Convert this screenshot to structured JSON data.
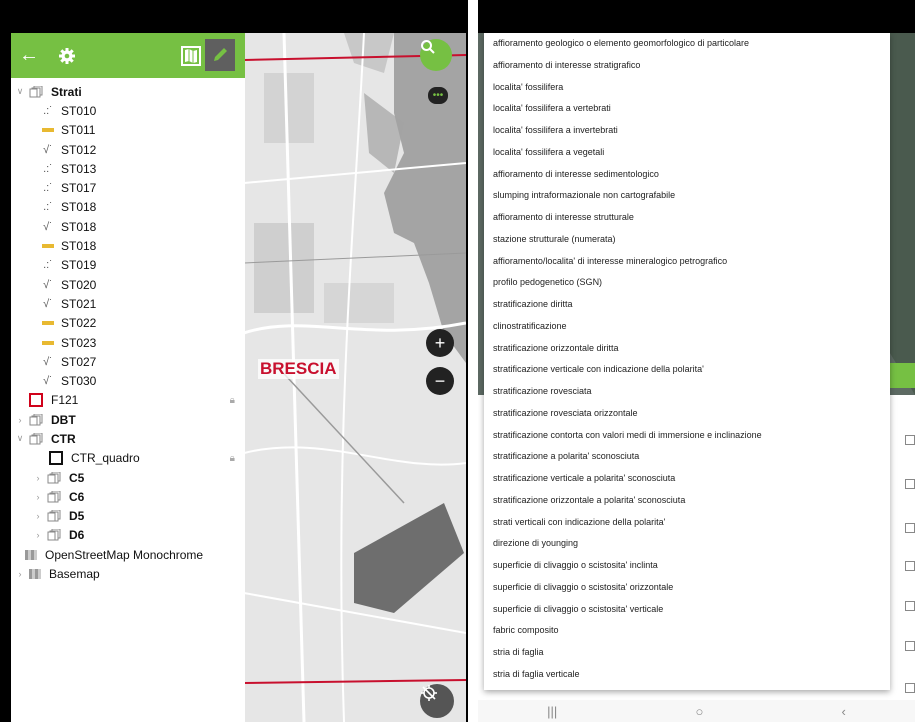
{
  "toolbar": {
    "back_icon": "arrow-left-icon",
    "settings_icon": "gear-icon",
    "map_icon": "map-icon",
    "edit_icon": "pencil-icon"
  },
  "tree": {
    "strati": {
      "label": "Strati"
    },
    "strati_items": [
      {
        "label": "ST010",
        "symbol": "dots"
      },
      {
        "label": "ST011",
        "symbol": "bar"
      },
      {
        "label": "ST012",
        "symbol": "check"
      },
      {
        "label": "ST013",
        "symbol": "dots"
      },
      {
        "label": "ST017",
        "symbol": "dots"
      },
      {
        "label": "ST018",
        "symbol": "dots"
      },
      {
        "label": "ST018",
        "symbol": "check"
      },
      {
        "label": "ST018",
        "symbol": "bar"
      },
      {
        "label": "ST019",
        "symbol": "dots"
      },
      {
        "label": "ST020",
        "symbol": "check"
      },
      {
        "label": "ST021",
        "symbol": "check"
      },
      {
        "label": "ST022",
        "symbol": "bar"
      },
      {
        "label": "ST023",
        "symbol": "bar"
      },
      {
        "label": "ST027",
        "symbol": "check"
      },
      {
        "label": "ST030",
        "symbol": "check"
      }
    ],
    "f121": {
      "label": "F121"
    },
    "dbt": {
      "label": "DBT"
    },
    "ctr": {
      "label": "CTR"
    },
    "ctr_quadro": {
      "label": "CTR_quadro"
    },
    "ctr_children": [
      {
        "label": "C5"
      },
      {
        "label": "C6"
      },
      {
        "label": "D5"
      },
      {
        "label": "D6"
      }
    ],
    "osm": {
      "label": "OpenStreetMap Monochrome"
    },
    "basemap": {
      "label": "Basemap"
    }
  },
  "map": {
    "city_label": "BRESCIA",
    "search_icon": "search-icon",
    "chat_icon": "chat-bubble-icon",
    "zoom_in": "+",
    "zoom_out": "−",
    "locate_icon": "gps-off-icon"
  },
  "colors": {
    "accent_green": "#76c043",
    "symbol_yellow": "#e8b931",
    "city_red": "#c8102e",
    "f121_red": "#d0021b"
  },
  "dropdown": {
    "items": [
      "affioramento geologico o elemento geomorfologico di particolare",
      "affioramento di interesse stratigrafico",
      "localita' fossilifera",
      "localita' fossilifera a vertebrati",
      "localita' fossilifera a invertebrati",
      "localita' fossilifera a vegetali",
      "affioramento di interesse sedimentologico",
      "slumping intraformazionale non cartografabile",
      "affioramento di interesse strutturale",
      "stazione strutturale (numerata)",
      "affioramento/localita' di interesse mineralogico petrografico",
      "profilo pedogenetico (SGN)",
      "stratificazione diritta",
      "clinostratificazione",
      "stratificazione orizzontale diritta",
      "stratificazione verticale con indicazione della polarita'",
      "stratificazione rovesciata",
      "stratificazione rovesciata orizzontale",
      "stratificazione contorta con valori medi di immersione e inclinazione",
      "stratificazione a polarita' sconosciuta",
      "stratificazione verticale a polarita' sconosciuta",
      "stratificazione orizzontale a polarita' sconosciuta",
      "strati verticali con indicazione della polarita'",
      "direzione di younging",
      "superficie di clivaggio o scistosita' inclinta",
      "superficie di clivaggio o scistosita' orizzontale",
      "superficie di clivaggio o scistosita' verticale",
      "fabric composito",
      "stria di faglia",
      "stria di faglia verticale"
    ]
  },
  "navbar": {
    "recent": "|||",
    "home": "○",
    "back": "‹"
  }
}
